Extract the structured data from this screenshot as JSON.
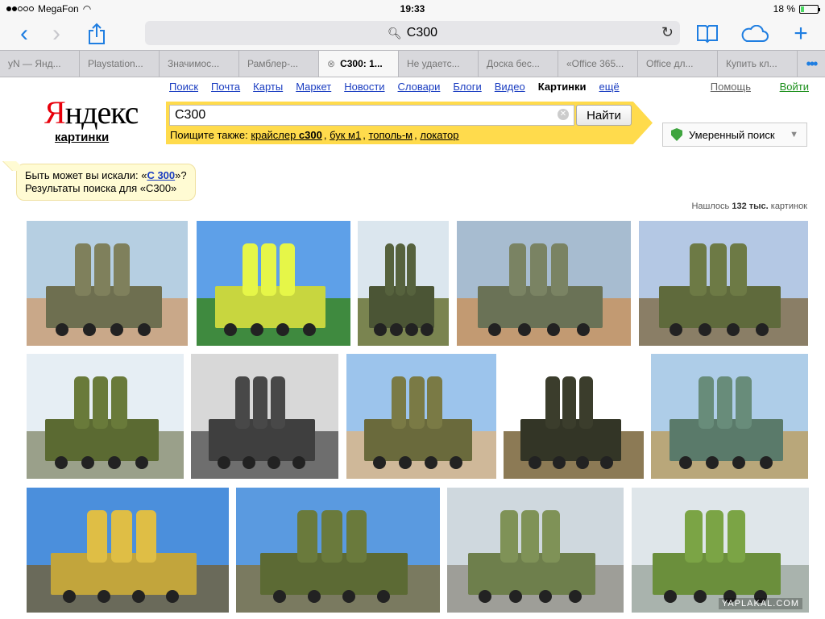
{
  "status": {
    "carrier": "MegaFon",
    "time": "19:33",
    "battery": "18 %",
    "battery_level": 0.18
  },
  "browser": {
    "url_text": "C300",
    "tabs": [
      {
        "label": "yN — Янд..."
      },
      {
        "label": "Playstation..."
      },
      {
        "label": "Значимос..."
      },
      {
        "label": "Рамблер-..."
      },
      {
        "label": "C300: 1...",
        "active": true
      },
      {
        "label": "Не удаетс..."
      },
      {
        "label": "Доска бес..."
      },
      {
        "label": "«Office 365..."
      },
      {
        "label": "Office дл..."
      },
      {
        "label": "Купить кл..."
      }
    ]
  },
  "nav": {
    "items": [
      "Поиск",
      "Почта",
      "Карты",
      "Маркет",
      "Новости",
      "Словари",
      "Блоги",
      "Видео"
    ],
    "current": "Картинки",
    "more": "ещё",
    "help": "Помощь",
    "login": "Войти"
  },
  "logo": {
    "y": "Я",
    "rest": "ндекс",
    "sub": "картинки"
  },
  "search": {
    "value": "C300",
    "button": "Найти",
    "also_label": "Поищите также:",
    "also_pre": "крайслер ",
    "also_bold": "с300",
    "also_links": [
      "бук м1",
      "тополь-м",
      "локатор"
    ],
    "safe": "Умеренный поиск"
  },
  "suggest": {
    "prefix": "Быть может вы искали: «",
    "link": "С 300",
    "suffix": "»?",
    "line2": "Результаты поиска для «C300»"
  },
  "results": {
    "prefix": "Нашлось ",
    "count": "132 тыс.",
    "suffix": " картинок"
  },
  "images": {
    "watermark": "YAPLAKAL.COM",
    "rows": [
      [
        {
          "name": "s300-1",
          "sky": "#b6cfe2",
          "ground": "#c9a889",
          "veh": "#6e6f50"
        },
        {
          "name": "s300-2",
          "sky": "#5ea0e8",
          "ground": "#3f8a3f",
          "veh": "#c8d63f"
        },
        {
          "name": "s300-3",
          "sky": "#dbe6ee",
          "ground": "#7a8450",
          "veh": "#4b5535"
        },
        {
          "name": "s300-4",
          "sky": "#a7bcd0",
          "ground": "#c29a72",
          "veh": "#6a7256"
        },
        {
          "name": "s300-5",
          "sky": "#b4c8e4",
          "ground": "#8a7e66",
          "veh": "#5f6a3c"
        }
      ],
      [
        {
          "name": "s300-6",
          "sky": "#e6eef4",
          "ground": "#9aa08a",
          "veh": "#5b6a32"
        },
        {
          "name": "s300-7",
          "sky": "#d8d8d8",
          "ground": "#6e6e6e",
          "veh": "#3f3f3f"
        },
        {
          "name": "s300-8",
          "sky": "#9cc4ec",
          "ground": "#cfb899",
          "veh": "#6a6a3c"
        },
        {
          "name": "s300-9",
          "sky": "#ffffff",
          "ground": "#8c7a55",
          "veh": "#333526"
        },
        {
          "name": "s300-10",
          "sky": "#aecde8",
          "ground": "#b9a77a",
          "veh": "#5a7a6a"
        }
      ],
      [
        {
          "name": "s300-11",
          "sky": "#4b8fdc",
          "ground": "#6a6a5a",
          "veh": "#c2a53c"
        },
        {
          "name": "s300-12",
          "sky": "#5a9ae0",
          "ground": "#7a7a60",
          "veh": "#5c6a34"
        },
        {
          "name": "s300-13",
          "sky": "#cfd8de",
          "ground": "#9e9e98",
          "veh": "#6e7f4c"
        },
        {
          "name": "s300-14",
          "sky": "#dfe6ea",
          "ground": "#a9b3ad",
          "veh": "#6b8f3c"
        }
      ]
    ]
  }
}
